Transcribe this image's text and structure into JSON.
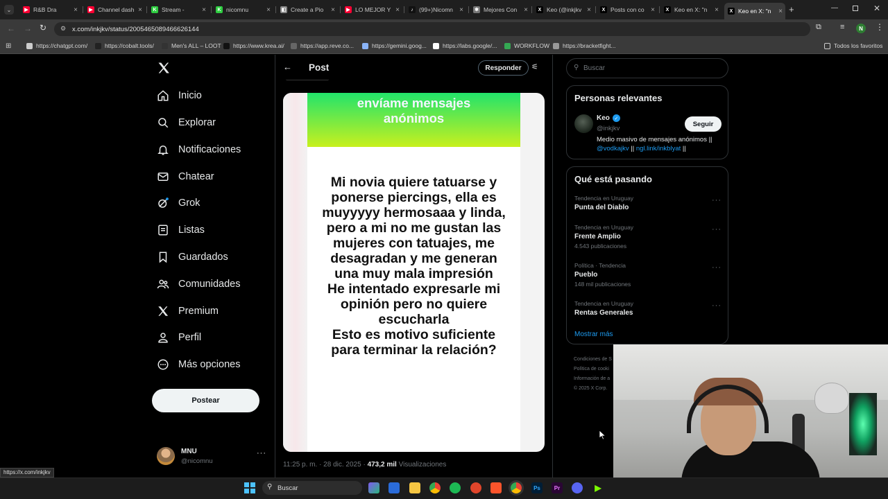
{
  "browser": {
    "tabs": [
      {
        "title": "R&B Dra",
        "color": "#ff0033",
        "glyph": "▶"
      },
      {
        "title": "Channel dash",
        "color": "#ff0033",
        "glyph": "▶"
      },
      {
        "title": "Stream -",
        "color": "#2ecc40",
        "glyph": "K"
      },
      {
        "title": "nicomnu",
        "color": "#2ecc40",
        "glyph": "K"
      },
      {
        "title": "Create a Pio",
        "color": "#888888",
        "glyph": "◧"
      },
      {
        "title": "LO MEJOR Y",
        "color": "#ff0033",
        "glyph": "▶"
      },
      {
        "title": "(99+)Nicomn",
        "color": "#111111",
        "glyph": "♪"
      },
      {
        "title": "Mejores Con",
        "color": "#777777",
        "glyph": "✱"
      },
      {
        "title": "Keo (@inkjkv",
        "color": "#000000",
        "glyph": "X"
      },
      {
        "title": "Posts con co",
        "color": "#000000",
        "glyph": "X"
      },
      {
        "title": "Keo en X: \"n",
        "color": "#000000",
        "glyph": "X"
      },
      {
        "title": "Keo en X: \"n",
        "color": "#000000",
        "glyph": "X"
      }
    ],
    "url": "x.com/inkjkv/status/2005465089466626144",
    "profile_initial": "N",
    "bookmarks": [
      {
        "label": "https://chatgpt.com/",
        "color": "#cccccc"
      },
      {
        "label": "https://cobalt.tools/",
        "color": "#222222"
      },
      {
        "label": "Men's ALL – LOOT",
        "color": "#333333"
      },
      {
        "label": "https://www.krea.ai/",
        "color": "#111111"
      },
      {
        "label": "https://app.reve.co...",
        "color": "#666666"
      },
      {
        "label": "https://gemini.goog...",
        "color": "#8ab4f8"
      },
      {
        "label": "https://labs.google/...",
        "color": "#ffffff"
      },
      {
        "label": "WORKFLOW",
        "color": "#34a853"
      },
      {
        "label": "https://bracketfight...",
        "color": "#999999"
      }
    ],
    "bookmarks_all": "Todos los favoritos",
    "status_url": "https://x.com/inkjkv"
  },
  "sidebar": {
    "items": [
      {
        "label": "Inicio",
        "icon": "home-icon"
      },
      {
        "label": "Explorar",
        "icon": "search-icon"
      },
      {
        "label": "Notificaciones",
        "icon": "bell-icon"
      },
      {
        "label": "Chatear",
        "icon": "mail-icon"
      },
      {
        "label": "Grok",
        "icon": "grok-icon"
      },
      {
        "label": "Listas",
        "icon": "list-icon"
      },
      {
        "label": "Guardados",
        "icon": "bookmark-icon"
      },
      {
        "label": "Comunidades",
        "icon": "people-icon"
      },
      {
        "label": "Premium",
        "icon": "x-logo-icon"
      },
      {
        "label": "Perfil",
        "icon": "person-icon"
      },
      {
        "label": "Más opciones",
        "icon": "more-circle-icon"
      }
    ],
    "post_button": "Postear",
    "account": {
      "name": "MNU",
      "handle": "@nicomnu"
    }
  },
  "post": {
    "header_title": "Post",
    "reply_button": "Responder",
    "image_banner": "envíame mensajes anónimos",
    "image_message": "Mi novia quiere tatuarse y ponerse piercings, ella es muyyyyy hermosaaa y linda, pero a mi no me gustan las mujeres con tatuajes, me desagradan y me generan una muy mala impresión\nHe intentado expresarle mi opinión pero no quiere escucharla\nEsto es motivo suficiente para terminar la relación?",
    "time": "11:25 p. m. · 28 dic. 2025 ·",
    "views_count": "473,2 mil",
    "views_label": "Visualizaciones"
  },
  "right": {
    "search_placeholder": "Buscar",
    "relevant": {
      "title": "Personas relevantes",
      "name": "Keo",
      "handle": "@inkjkv",
      "follow": "Seguir",
      "bio_text": "Medio masivo de mensajes anónimos",
      "bio_sep1": "||",
      "bio_link1": "@vodkajkv",
      "bio_sep2": "||",
      "bio_link2": "ngl.link/inkblyat",
      "bio_sep3": "||"
    },
    "trends": {
      "title": "Qué está pasando",
      "items": [
        {
          "meta": "Tendencia en Uruguay",
          "title": "Punta del Diablo",
          "count": ""
        },
        {
          "meta": "Tendencia en Uruguay",
          "title": "Frente Amplio",
          "count": "4.543 publicaciones"
        },
        {
          "meta": "Política · Tendencia",
          "title": "Pueblo",
          "count": "148 mil publicaciones"
        },
        {
          "meta": "Tendencia en Uruguay",
          "title": "Rentas Generales",
          "count": ""
        }
      ],
      "show_more": "Mostrar más"
    },
    "footer": [
      "Condiciones de S",
      "Política de cooki",
      "Información de a",
      "© 2025 X Corp."
    ]
  },
  "taskbar": {
    "search": "Buscar"
  },
  "colors": {
    "accent": "#1d9bf0",
    "banner_top": "#22e36b",
    "banner_bottom": "#c8f01e",
    "verified": "#1d9bf0"
  }
}
